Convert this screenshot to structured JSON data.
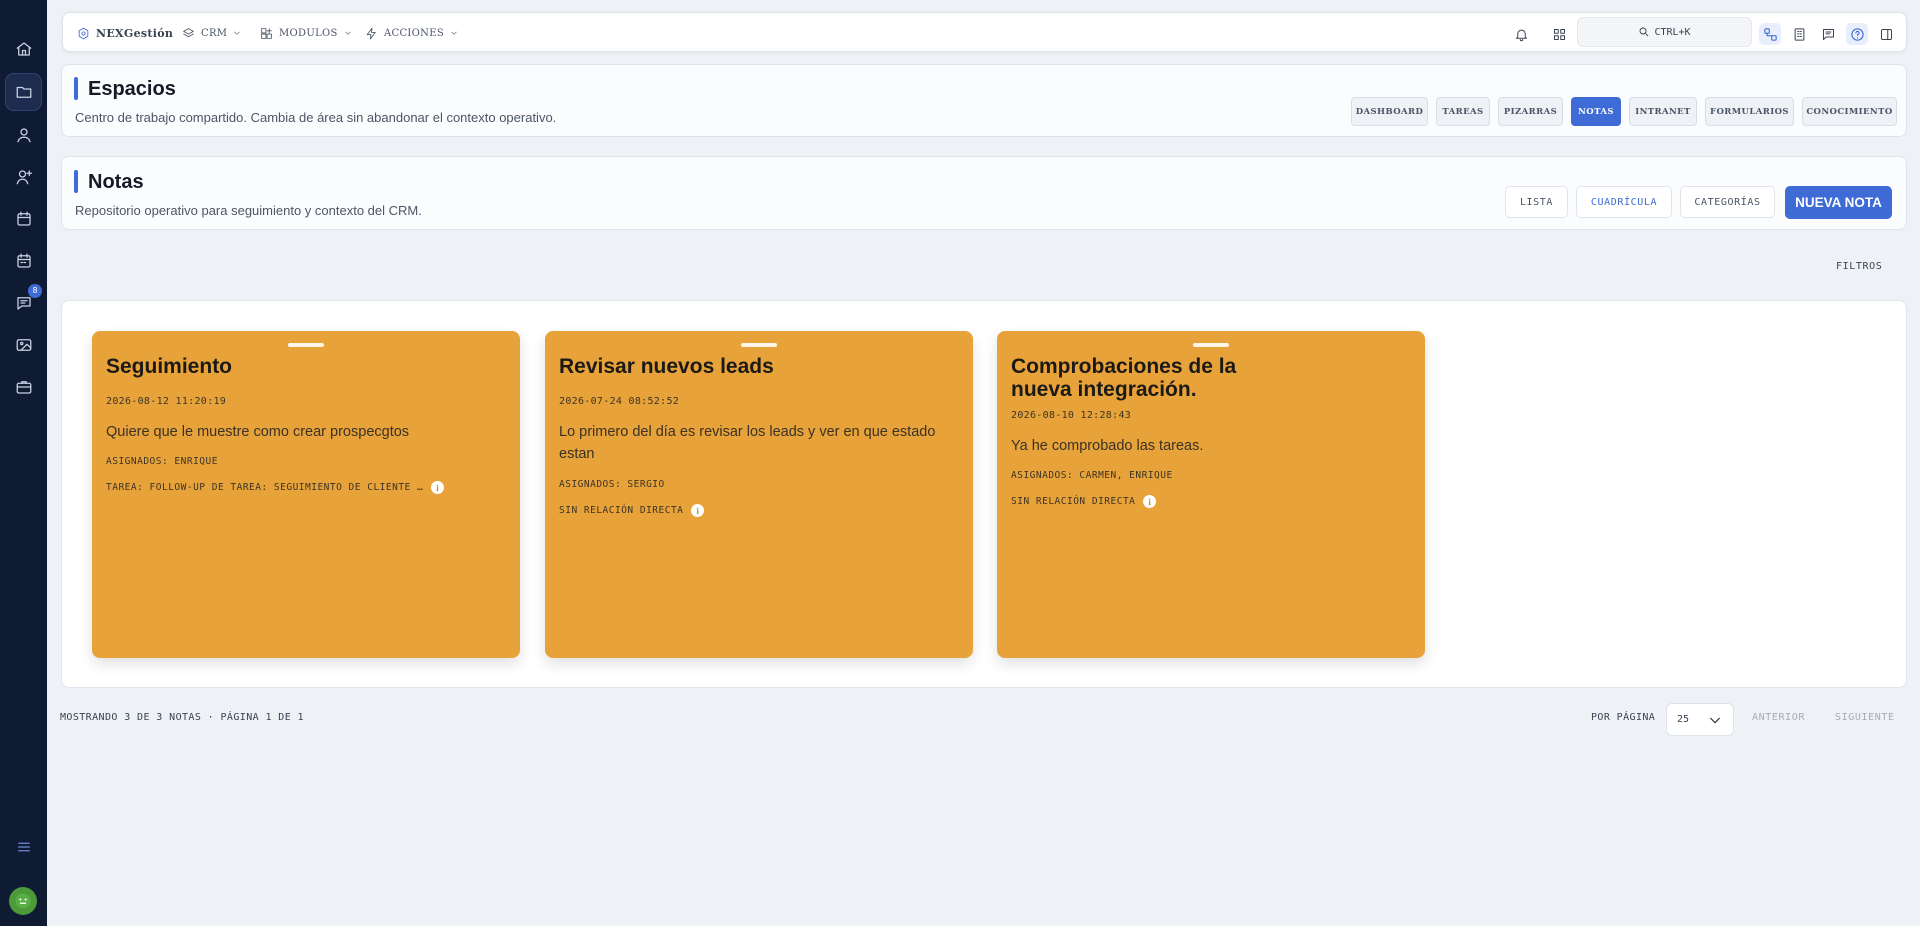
{
  "sidebar": {
    "items": [
      {
        "name": "home-icon"
      },
      {
        "name": "folder-icon"
      },
      {
        "name": "user-icon"
      },
      {
        "name": "user-add-icon"
      },
      {
        "name": "calendar-icon"
      },
      {
        "name": "calendar-alt-icon"
      },
      {
        "name": "chat-icon"
      },
      {
        "name": "image-icon"
      },
      {
        "name": "briefcase-icon"
      }
    ],
    "chat_badge": "8",
    "active_item": "folder-icon"
  },
  "topbar": {
    "brand": "NEXGestión",
    "menus": [
      "CRM",
      "MODULOS",
      "ACCIONES"
    ],
    "search_label": "CTRL+K"
  },
  "workspace": {
    "title": "Espacios",
    "subtitle": "Centro de trabajo compartido. Cambia de área sin abandonar el contexto operativo.",
    "tabs": [
      "DASHBOARD",
      "TAREAS",
      "PIZARRAS",
      "NOTAS",
      "INTRANET",
      "FORMULARIOS",
      "CONOCIMIENTO"
    ],
    "active_tab": "NOTAS"
  },
  "notes_header": {
    "title": "Notas",
    "subtitle": "Repositorio operativo para seguimiento y contexto del CRM.",
    "views": [
      "LISTA",
      "CUADRÍCULA",
      "CATEGORÍAS"
    ],
    "selected_view": "CUADRÍCULA",
    "new_button": "NUEVA NOTA"
  },
  "filters_label": "FILTROS",
  "notes": [
    {
      "title": "Seguimiento",
      "date": "2026-08-12 11:20:19",
      "body": "Quiere que le muestre como crear prospecgtos",
      "assigned": "ASIGNADOS: ENRIQUE",
      "relation": "TAREA: FOLLOW-UP DE TAREA: SEGUIMIENTO DE CLIENTE …"
    },
    {
      "title": "Revisar nuevos leads",
      "date": "2026-07-24 08:52:52",
      "body": "Lo primero del día es revisar los leads y ver en que estado estan",
      "assigned": "ASIGNADOS: SERGIO",
      "relation": "SIN RELACIÓN DIRECTA"
    },
    {
      "title": "Comprobaciones de la nueva integración.",
      "date": "2026-08-10 12:28:43",
      "body": "Ya he comprobado las tareas.",
      "assigned": "ASIGNADOS: CARMEN, ENRIQUE",
      "relation": "SIN RELACIÓN DIRECTA"
    }
  ],
  "note_color": "#e8a23a",
  "accent_color": "#3e6bd6",
  "footer": {
    "summary": "MOSTRANDO 3 DE 3 NOTAS · PÁGINA 1 DE 1",
    "per_page_label": "POR PÁGINA",
    "per_page_value": "25",
    "prev": "ANTERIOR",
    "next": "SIGUIENTE"
  }
}
